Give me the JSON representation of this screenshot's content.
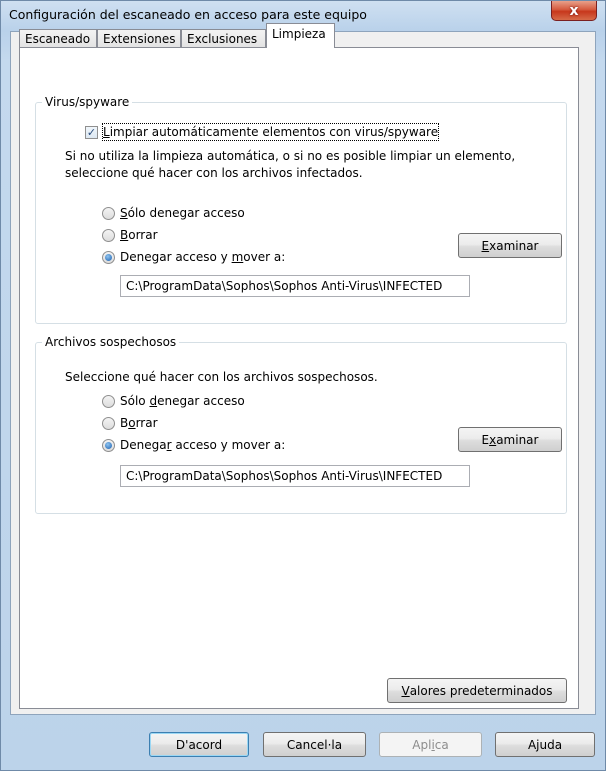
{
  "window": {
    "title": "Configuración del escaneado en acceso para este equipo",
    "close_glyph": "x"
  },
  "tabs": [
    {
      "label": "Escaneado"
    },
    {
      "label": "Extensiones"
    },
    {
      "label": "Exclusiones"
    },
    {
      "label": "Limpieza"
    }
  ],
  "virus_group": {
    "title": "Virus/spyware",
    "auto_clean": {
      "checked": true,
      "pre": "L",
      "post": "impiar automáticamente elementos con virus/spyware"
    },
    "description_1": "Si no utiliza la limpieza automática, o si no es posible limpiar un elemento,",
    "description_2": "seleccione qué hacer con los archivos infectados.",
    "option_deny": {
      "key": "S",
      "rest": "ólo denegar acceso"
    },
    "option_delete": {
      "key": "B",
      "rest": "orrar"
    },
    "option_move": {
      "pre": "Denegar acceso y ",
      "key": "m",
      "rest": "over a:",
      "selected": true
    },
    "browse_button": {
      "key": "E",
      "rest": "xaminar"
    },
    "path": "C:\\ProgramData\\Sophos\\Sophos Anti-Virus\\INFECTED"
  },
  "suspicious_group": {
    "title": "Archivos sospechosos",
    "description": "Seleccione qué hacer con los archivos sospechosos.",
    "option_deny": {
      "pre": "Sólo ",
      "key": "d",
      "rest": "enegar acceso"
    },
    "option_delete": {
      "pre": "B",
      "key": "o",
      "rest": "rrar"
    },
    "option_move": {
      "pre": "Denega",
      "key": "r",
      "rest": " acceso y mover a:",
      "selected": true
    },
    "browse_button": {
      "pre": "E",
      "key": "x",
      "rest": "aminar"
    },
    "path": "C:\\ProgramData\\Sophos\\Sophos Anti-Virus\\INFECTED"
  },
  "defaults_button": {
    "key": "V",
    "rest": "alores predeterminados"
  },
  "footer": {
    "ok": "D'acord",
    "cancel": "Cancel·la",
    "apply": {
      "pre": "Apl",
      "key": "i",
      "rest": "ca"
    },
    "help": "Ajuda"
  }
}
